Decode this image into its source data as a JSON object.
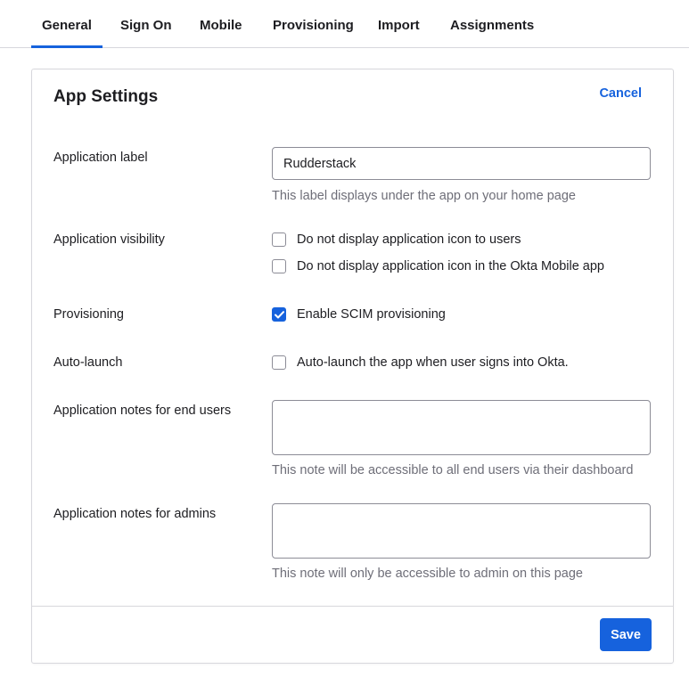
{
  "tabs": [
    {
      "label": "General",
      "active": true
    },
    {
      "label": "Sign On"
    },
    {
      "label": "Mobile"
    },
    {
      "label": "Provisioning"
    },
    {
      "label": "Import"
    },
    {
      "label": "Assignments"
    }
  ],
  "panel": {
    "title": "App Settings",
    "cancel_label": "Cancel",
    "save_label": "Save"
  },
  "fields": {
    "app_label": {
      "label": "Application label",
      "value": "Rudderstack",
      "hint": "This label displays under the app on your home page"
    },
    "visibility": {
      "label": "Application visibility",
      "options": [
        {
          "text": "Do not display application icon to users",
          "checked": false
        },
        {
          "text": "Do not display application icon in the Okta Mobile app",
          "checked": false
        }
      ]
    },
    "provisioning": {
      "label": "Provisioning",
      "option": {
        "text": "Enable SCIM provisioning",
        "checked": true
      }
    },
    "auto_launch": {
      "label": "Auto-launch",
      "option": {
        "text": "Auto-launch the app when user signs into Okta.",
        "checked": false
      }
    },
    "notes_end_users": {
      "label": "Application notes for end users",
      "value": "",
      "hint": "This note will be accessible to all end users via their dashboard"
    },
    "notes_admins": {
      "label": "Application notes for admins",
      "value": "",
      "hint": "This note will only be accessible to admin on this page"
    }
  },
  "colors": {
    "accent": "#1662dd",
    "border": "#d7d7dc",
    "hint_text": "#6e6e78"
  }
}
